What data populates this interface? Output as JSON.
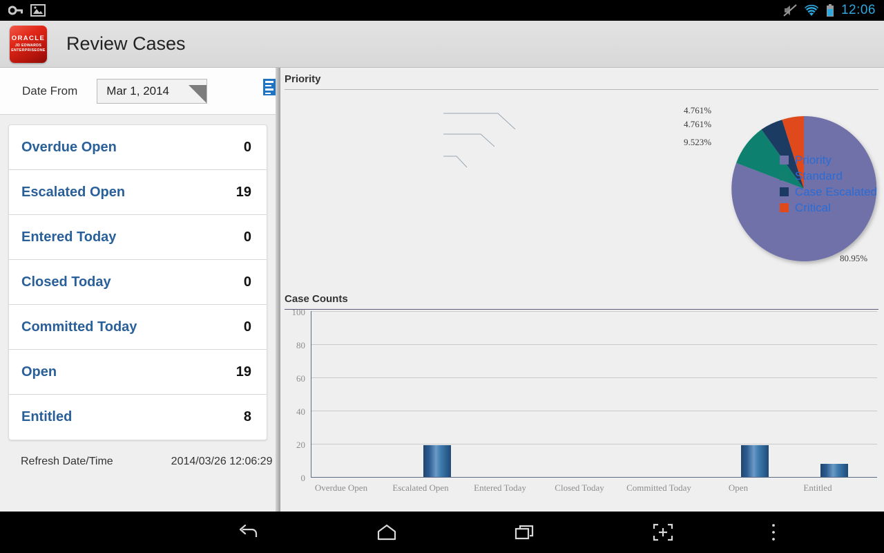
{
  "statusbar": {
    "left_icons": [
      "key-icon",
      "image-icon"
    ],
    "right_icons": [
      "mute-icon",
      "wifi-icon",
      "battery-icon"
    ],
    "clock": "12:06",
    "clock_color": "#2fa8e0"
  },
  "titlebar": {
    "logo": {
      "line1": "ORACLE",
      "line2": "JD EDWARDS",
      "line3": "ENTERPRISEONE",
      "color": "#d42318"
    },
    "title": "Review Cases"
  },
  "left_panel": {
    "date_from_label": "Date From",
    "date_from_value": "Mar 1, 2014",
    "list_icon_name": "report-list-icon",
    "kpis": [
      {
        "label": "Overdue Open",
        "value": "0"
      },
      {
        "label": "Escalated Open",
        "value": "19"
      },
      {
        "label": "Entered Today",
        "value": "0"
      },
      {
        "label": "Closed Today",
        "value": "0"
      },
      {
        "label": "Committed Today",
        "value": "0"
      },
      {
        "label": "Open",
        "value": "19"
      },
      {
        "label": "Entitled",
        "value": "8"
      }
    ],
    "refresh_label": "Refresh Date/Time",
    "refresh_value": "2014/03/26 12:06:29"
  },
  "chart_data": [
    {
      "type": "pie",
      "title": "Priority",
      "categories": [
        "Priority",
        "Standard",
        "Case Escalated",
        "Critical"
      ],
      "values": [
        80.95,
        9.523,
        4.761,
        4.761
      ],
      "labels": [
        "80.95%",
        "9.523%",
        "4.761%",
        "4.761%"
      ],
      "colors": [
        "#7071a8",
        "#11806f",
        "#1b3a63",
        "#e0491b"
      ],
      "legend": {
        "position": "right",
        "entries": [
          {
            "label": "Priority",
            "color": "#7071a8"
          },
          {
            "label": "Standard",
            "color": "#11806f"
          },
          {
            "label": "Case Escalated",
            "color": "#1b3a63"
          },
          {
            "label": "Critical",
            "color": "#e0491b"
          }
        ]
      },
      "xlabel": "",
      "ylabel": "",
      "grid": false
    },
    {
      "type": "bar",
      "title": "Case Counts",
      "categories": [
        "Overdue Open",
        "Escalated Open",
        "Entered Today",
        "Closed Today",
        "Committed Today",
        "Open",
        "Entitled"
      ],
      "values": [
        0,
        19,
        0,
        0,
        0,
        19,
        8
      ],
      "yticks": [
        "100",
        "80",
        "60",
        "40",
        "20",
        "0"
      ],
      "ylim": [
        0,
        100
      ],
      "xlabel": "",
      "ylabel": "",
      "grid": true,
      "bar_color": "#2e5d92"
    }
  ],
  "navbar": {
    "buttons": [
      "back-icon",
      "home-icon",
      "recents-icon",
      "screenshot-icon",
      "overflow-menu-icon"
    ]
  }
}
